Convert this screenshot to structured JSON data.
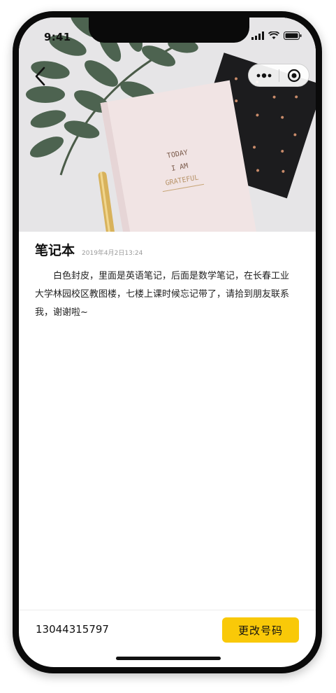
{
  "status_bar": {
    "time": "9:41"
  },
  "nav": {
    "back_icon": "chevron-left-icon",
    "more_icon": "more-dots-icon",
    "close_icon": "target-close-icon"
  },
  "hero": {
    "notebook_text": [
      "TODAY",
      "I AM",
      "GRATEFUL"
    ]
  },
  "item": {
    "title": "笔记本",
    "date": "2019年4月2日13:24",
    "description": "白色封皮，里面是英语笔记，后面是数学笔记，在长春工业大学林园校区教图楼，七楼上课时候忘记带了，请拾到朋友联系我，谢谢啦~"
  },
  "footer": {
    "phone": "13044315797",
    "change_button": "更改号码"
  },
  "colors": {
    "accent": "#f9c908"
  }
}
